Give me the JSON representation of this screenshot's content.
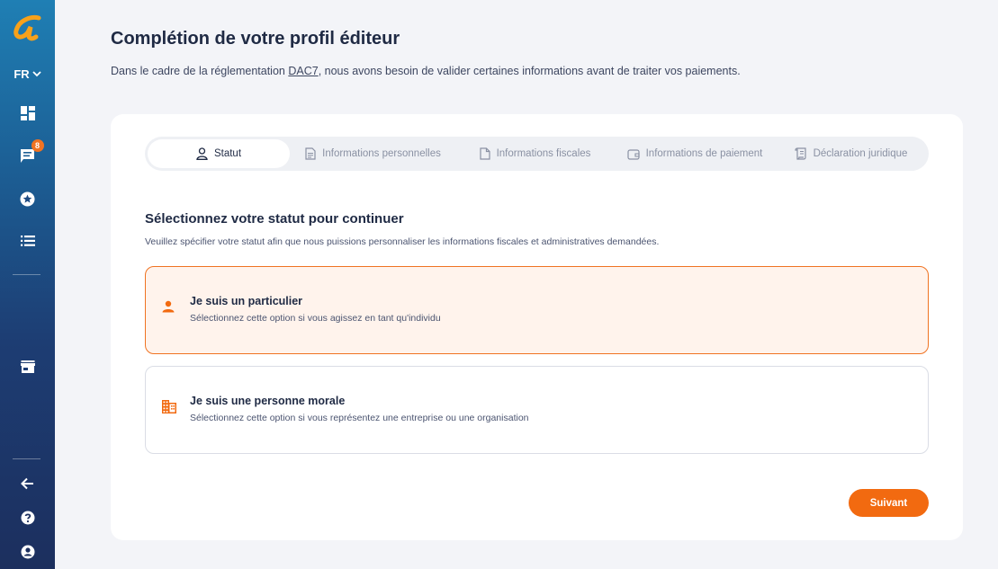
{
  "sidebar": {
    "language": "FR",
    "messages_badge": "8",
    "icons": [
      "logo-icon",
      "dashboard-icon",
      "messages-icon",
      "favorites-icon",
      "list-icon",
      "store-icon",
      "back-arrow-icon",
      "help-icon",
      "account-icon"
    ]
  },
  "header": {
    "title": "Complétion de votre profil éditeur",
    "subtitle_before": "Dans le cadre de la réglementation ",
    "subtitle_link": "DAC7",
    "subtitle_after": ", nous avons besoin de valider certaines informations avant de traiter vos paiements."
  },
  "steps": [
    {
      "label": "Statut",
      "icon": "user-icon",
      "active": true
    },
    {
      "label": "Informations personnelles",
      "icon": "document-icon",
      "active": false
    },
    {
      "label": "Informations fiscales",
      "icon": "file-icon",
      "active": false
    },
    {
      "label": "Informations de paiement",
      "icon": "wallet-icon",
      "active": false
    },
    {
      "label": "Déclaration juridique",
      "icon": "scroll-icon",
      "active": false
    }
  ],
  "section": {
    "title": "Sélectionnez votre statut pour continuer",
    "subtitle": "Veuillez spécifier votre statut afin que nous puissions personnaliser les informations fiscales et administratives demandées."
  },
  "options": [
    {
      "title": "Je suis un particulier",
      "description": "Sélectionnez cette option si vous agissez en tant qu'individu",
      "selected": true
    },
    {
      "title": "Je suis une personne morale",
      "description": "Sélectionnez cette option si vous représentez une entreprise ou une organisation",
      "selected": false
    }
  ],
  "actions": {
    "next_label": "Suivant"
  },
  "colors": {
    "accent": "#f26a10",
    "selected_bg": "#fff3ec",
    "sidebar_top": "#1f7fb4",
    "sidebar_bottom": "#1c2f5e"
  }
}
